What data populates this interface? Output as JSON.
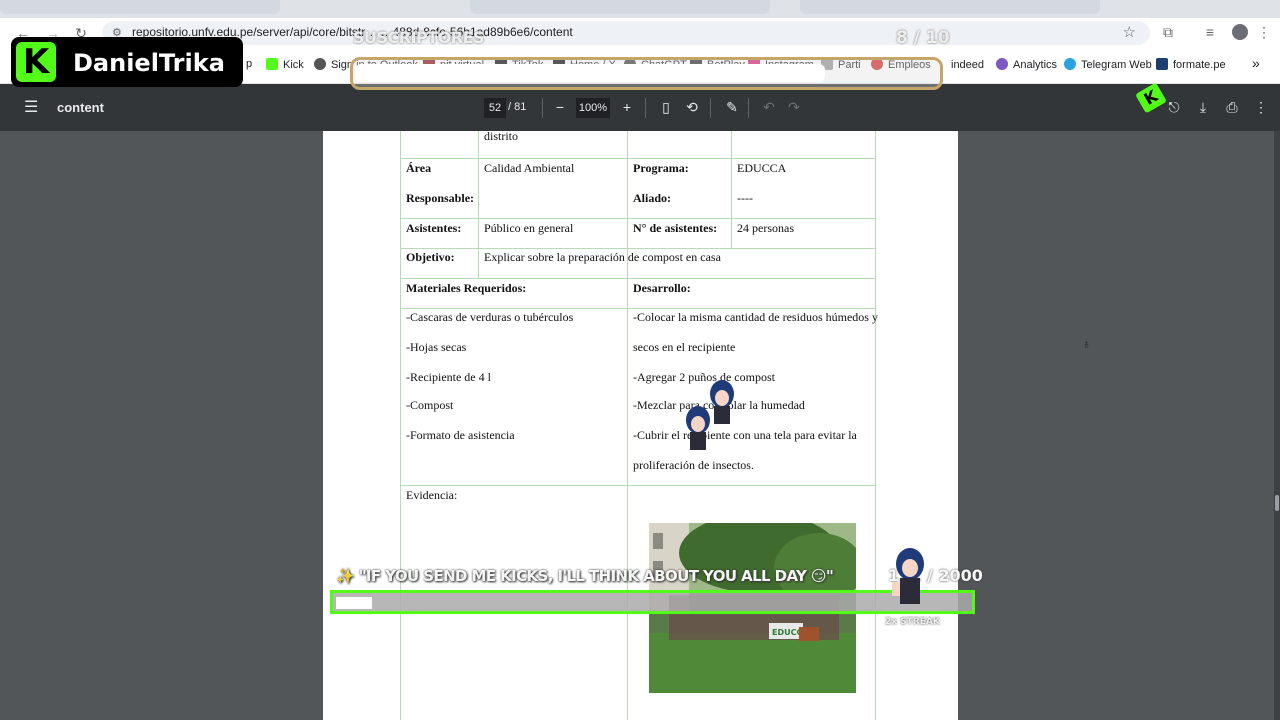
{
  "browser": {
    "url": "repositorio.unfv.edu.pe/server/api/core/bitstr… …488d-8cfe-56b1ad89b6e6/content",
    "bookmarks": [
      "p",
      "Kick",
      "Sign in to Outlook",
      "pit virtual",
      "TikTok",
      "Home / X",
      "ChatGPT",
      "BetPlay",
      "Instagram",
      "Parti",
      "Empleos",
      "indeed",
      "Analytics",
      "Telegram Web",
      "formate.pe"
    ],
    "bookmarks_more": "»"
  },
  "pdf_toolbar": {
    "title": "content",
    "current_page": "52",
    "total_pages": "/ 81",
    "zoom": "100%"
  },
  "document": {
    "row0_left": "distrito",
    "area_label": "Área",
    "responsable_label": "Responsable:",
    "area_value": "Calidad Ambiental",
    "programa_label": "Programa:",
    "programa_value": "EDUCCA",
    "aliado_label": "Aliado:",
    "aliado_value": "----",
    "asistentes_label": "Asistentes:",
    "asistentes_value": "Público en general",
    "n_asistentes_label": "N° de asistentes:",
    "n_asistentes_value": "24 personas",
    "objetivo_label": "Objetivo:",
    "objetivo_value": "Explicar sobre la preparación de compost en casa",
    "materiales_label": "Materiales Requeridos:",
    "desarrollo_label": "Desarrollo:",
    "materiales": [
      "-Cascaras de verduras o tubérculos",
      "-Hojas secas",
      "-Recipiente de 4 l",
      "-Compost",
      "-Formato de asistencia"
    ],
    "desarrollo": [
      "-Colocar la misma cantidad de residuos húmedos y",
      "secos en el recipiente",
      "-Agregar 2 puños de compost",
      "-Mezclar para controlar la humedad",
      "-Cubrir el recipiente con una tela para evitar la",
      "proliferación de insectos."
    ],
    "evidencia_label": "Evidencia:",
    "photo_banner": "EDUCCA"
  },
  "overlay": {
    "streamer_name": "DanielTrika",
    "logo_letter": "K",
    "subs_title": "SUSCRIPTORES",
    "subs_count": "8 / 10",
    "subs_progress": 0.8,
    "kicks_message": "✨ \"IF YOU SEND ME KICKS, I'LL THINK ABOUT YOU ALL DAY 😏\"",
    "kicks_count": "112 / 2000",
    "kicks_progress": 0.056,
    "streak": "2x STREAK"
  },
  "colors": {
    "kick_green": "#53fc18",
    "pdf_toolbar_bg": "#323639",
    "viewer_bg": "#525659",
    "table_border": "#b7dbb3"
  }
}
